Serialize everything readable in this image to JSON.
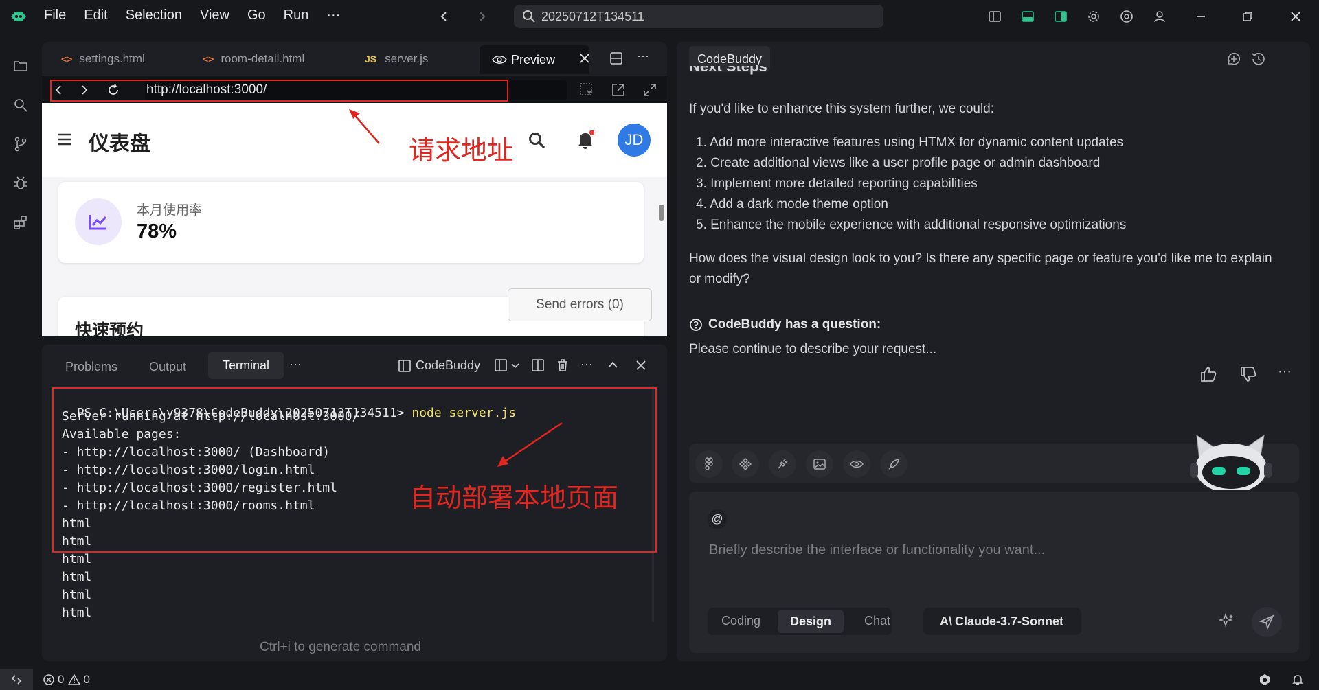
{
  "titlebar": {
    "menu": [
      "File",
      "Edit",
      "Selection",
      "View",
      "Go",
      "Run"
    ],
    "more": "···",
    "search_text": "20250712T134511"
  },
  "editor": {
    "tabs": [
      {
        "label": "settings.html",
        "icon": "html-icon"
      },
      {
        "label": "room-detail.html",
        "icon": "html-icon"
      },
      {
        "label": "server.js",
        "icon": "js-icon"
      }
    ],
    "preview_tab": "Preview",
    "url": "http://localhost:3000/"
  },
  "page": {
    "title": "仪表盘",
    "avatar": "JD",
    "stat_label": "本月使用率",
    "stat_value": "78%",
    "section_title": "快速预约",
    "send_errors": "Send errors (0)"
  },
  "annotations": {
    "url_note": "请求地址",
    "terminal_note": "自动部署本地页面"
  },
  "terminal_panel": {
    "tabs": [
      "Problems",
      "Output",
      "Terminal"
    ],
    "active_tab": "Terminal",
    "codebuddy_label": "CodeBuddy",
    "prompt": "PS C:\\Users\\y9378\\CodeBuddy\\20250712T134511>",
    "command": "node server.js",
    "lines": [
      "Server running at http://localhost:3000/",
      "Available pages:",
      "- http://localhost:3000/ (Dashboard)",
      "- http://localhost:3000/login.html",
      "- http://localhost:3000/register.html",
      "- http://localhost:3000/rooms.html",
      "html",
      "html",
      "html",
      "html",
      "html",
      "html"
    ],
    "hint": "Ctrl+i to generate command"
  },
  "chat": {
    "tab_label": "CodeBuddy",
    "partial_heading": "Next Steps",
    "intro": "If you'd like to enhance this system further, we could:",
    "items": [
      "Add more interactive features using HTMX for dynamic content updates",
      "Create additional views like a user profile page or admin dashboard",
      "Implement more detailed reporting capabilities",
      "Add a dark mode theme option",
      "Enhance the mobile experience with additional responsive optimizations"
    ],
    "question_line1": "How does the visual design look to you? Is there any specific page or feature you'd like me to explain",
    "question_line2": "or modify?",
    "has_question": "CodeBuddy has a question:",
    "continue_text": "Please continue to describe your request...",
    "input_mention": "@",
    "input_placeholder": "Briefly describe the interface or functionality you want...",
    "modes": [
      "Coding",
      "Design",
      "Chat"
    ],
    "active_mode": "Design",
    "model": "Claude-3.7-Sonnet"
  },
  "statusbar": {
    "errors": "0",
    "warnings": "0"
  }
}
